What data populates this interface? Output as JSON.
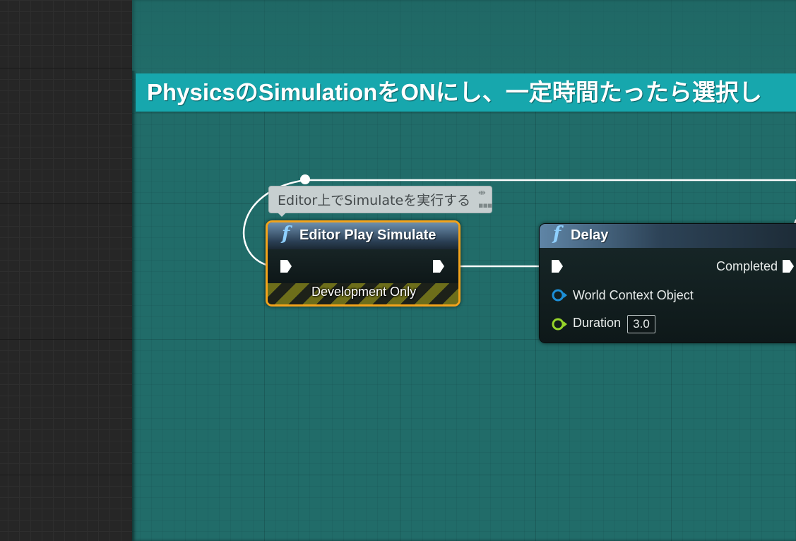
{
  "comment": {
    "title": "PhysicsのSimulationをONにし、一定時間たったら選択し",
    "color": "#17a7ad"
  },
  "node_comment": {
    "text": "Editor上でSimulateを実行する"
  },
  "editor_play_simulate": {
    "icon": "function-icon",
    "icon_glyph": "f",
    "title": "Editor Play Simulate",
    "footer_label": "Development Only",
    "border_color": "#f3a31b"
  },
  "delay": {
    "icon": "function-icon",
    "icon_glyph": "f",
    "title": "Delay",
    "outputs": {
      "completed_label": "Completed"
    },
    "inputs": {
      "world_context_label": "World Context Object",
      "duration_label": "Duration",
      "duration_value": "3.0"
    },
    "object_pin_color": "#1d8fd8",
    "float_pin_color": "#97d42a"
  }
}
